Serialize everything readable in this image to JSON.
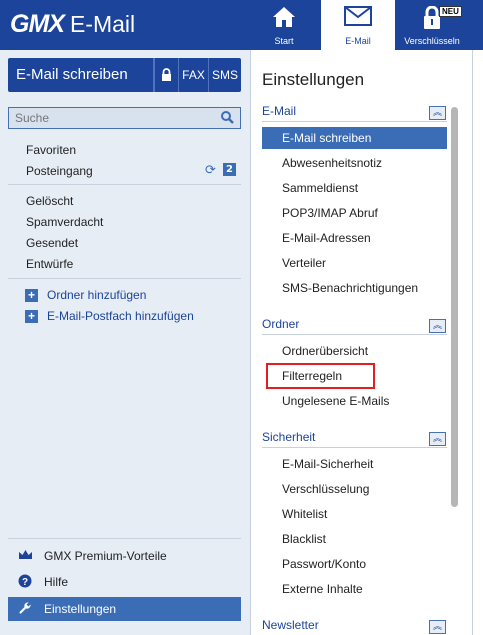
{
  "header": {
    "brand": "GMX",
    "product": "E-Mail",
    "nav": [
      {
        "label": "Start",
        "icon": "home-icon"
      },
      {
        "label": "E-Mail",
        "icon": "envelope-icon"
      },
      {
        "label": "Verschlüsseln",
        "icon": "lock-icon",
        "badge": "NEU"
      }
    ]
  },
  "sidebar": {
    "compose_label": "E-Mail schreiben",
    "fax_label": "FAX",
    "sms_label": "SMS",
    "search_placeholder": "Suche",
    "folders_top": [
      {
        "label": "Favoriten"
      },
      {
        "label": "Posteingang",
        "count": "2"
      }
    ],
    "folders_mid": [
      {
        "label": "Gelöscht"
      },
      {
        "label": "Spamverdacht"
      },
      {
        "label": "Gesendet"
      },
      {
        "label": "Entwürfe"
      }
    ],
    "add_folder": "Ordner hinzufügen",
    "add_mailbox": "E-Mail-Postfach hinzufügen",
    "footer": [
      {
        "label": "GMX Premium-Vorteile",
        "icon": "crown-icon"
      },
      {
        "label": "Hilfe",
        "icon": "help-icon"
      },
      {
        "label": "Einstellungen",
        "icon": "wrench-icon"
      }
    ]
  },
  "settings": {
    "title": "Einstellungen",
    "sections": [
      {
        "heading": "E-Mail",
        "items": [
          "E-Mail schreiben",
          "Abwesenheitsnotiz",
          "Sammeldienst",
          "POP3/IMAP Abruf",
          "E-Mail-Adressen",
          "Verteiler",
          "SMS-Benachrichtigungen"
        ]
      },
      {
        "heading": "Ordner",
        "items": [
          "Ordnerübersicht",
          "Filterregeln",
          "Ungelesene E-Mails"
        ]
      },
      {
        "heading": "Sicherheit",
        "items": [
          "E-Mail-Sicherheit",
          "Verschlüsselung",
          "Whitelist",
          "Blacklist",
          "Passwort/Konto",
          "Externe Inhalte"
        ]
      },
      {
        "heading": "Newsletter",
        "items": []
      }
    ]
  },
  "colors": {
    "brand": "#1c449b",
    "accent": "#3b6cb6",
    "highlight": "#e02020"
  }
}
